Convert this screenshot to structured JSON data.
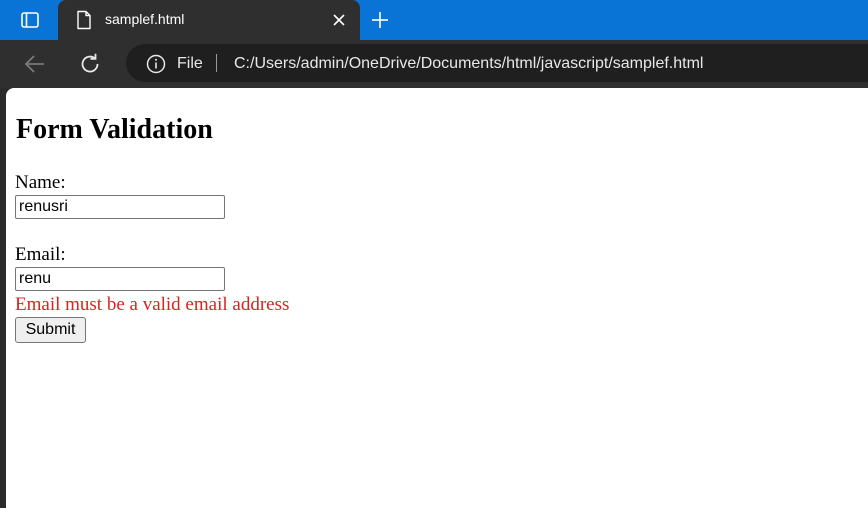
{
  "browser": {
    "tab": {
      "title": "samplef.html"
    },
    "address_bar": {
      "scheme_label": "File",
      "url": "C:/Users/admin/OneDrive/Documents/html/javascript/samplef.html"
    }
  },
  "page": {
    "title": "Form Validation",
    "name_field": {
      "label": "Name:",
      "value": "renusri"
    },
    "email_field": {
      "label": "Email:",
      "value": "renu"
    },
    "error_message": "Email must be a valid email address",
    "submit_label": "Submit"
  },
  "colors": {
    "tabstrip": "#0a74d6",
    "toolbar": "#2f2f2f",
    "error": "#e0201f"
  }
}
